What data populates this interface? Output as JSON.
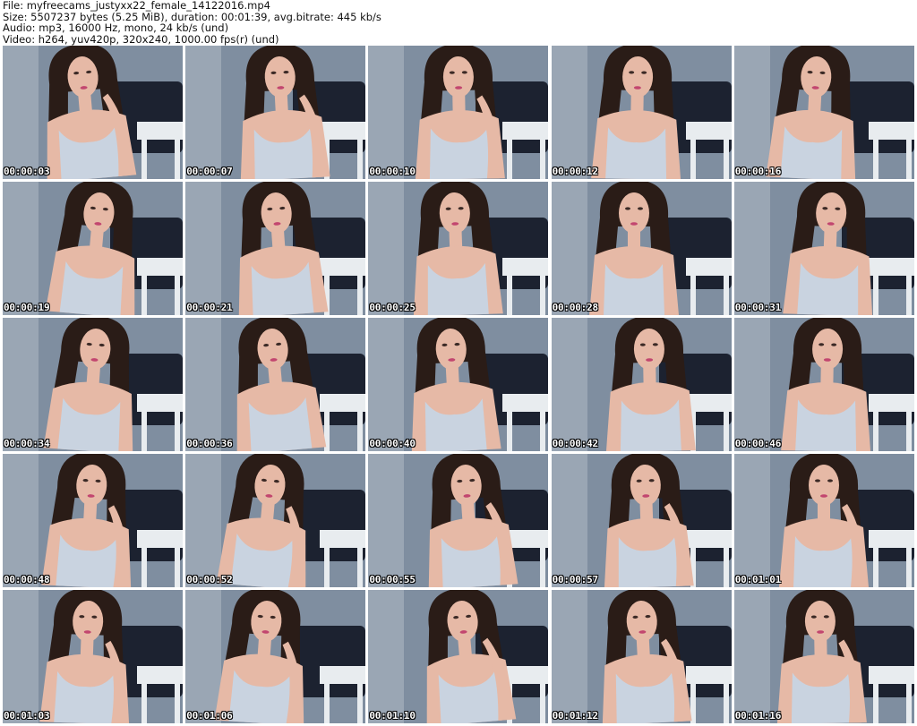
{
  "header": {
    "file_line": "File: myfreecams_justyxx22_female_14122016.mp4",
    "size_line": "Size: 5507237 bytes (5.25 MiB), duration: 00:01:39, avg.bitrate: 445 kb/s",
    "audio_line": "Audio: mp3, 16000 Hz, mono, 24 kb/s (und)",
    "video_line": "Video: h264, yuv420p, 320x240, 1000.00 fps(r) (und)"
  },
  "thumbnails": [
    {
      "timestamp": "00:00:03"
    },
    {
      "timestamp": "00:00:07"
    },
    {
      "timestamp": "00:00:10"
    },
    {
      "timestamp": "00:00:12"
    },
    {
      "timestamp": "00:00:16"
    },
    {
      "timestamp": "00:00:19"
    },
    {
      "timestamp": "00:00:21"
    },
    {
      "timestamp": "00:00:25"
    },
    {
      "timestamp": "00:00:28"
    },
    {
      "timestamp": "00:00:31"
    },
    {
      "timestamp": "00:00:34"
    },
    {
      "timestamp": "00:00:36"
    },
    {
      "timestamp": "00:00:40"
    },
    {
      "timestamp": "00:00:42"
    },
    {
      "timestamp": "00:00:46"
    },
    {
      "timestamp": "00:00:48"
    },
    {
      "timestamp": "00:00:52"
    },
    {
      "timestamp": "00:00:55"
    },
    {
      "timestamp": "00:00:57"
    },
    {
      "timestamp": "00:01:01"
    },
    {
      "timestamp": "00:01:03"
    },
    {
      "timestamp": "00:01:06"
    },
    {
      "timestamp": "00:01:10"
    },
    {
      "timestamp": "00:01:12"
    },
    {
      "timestamp": "00:01:16"
    }
  ],
  "colors": {
    "wall": "#7f8ea0",
    "chair": "#1c2230",
    "table": "#e8ecef",
    "skin": "#e6b9a6",
    "hair": "#2a1c17",
    "top": "#c9d3e0"
  }
}
